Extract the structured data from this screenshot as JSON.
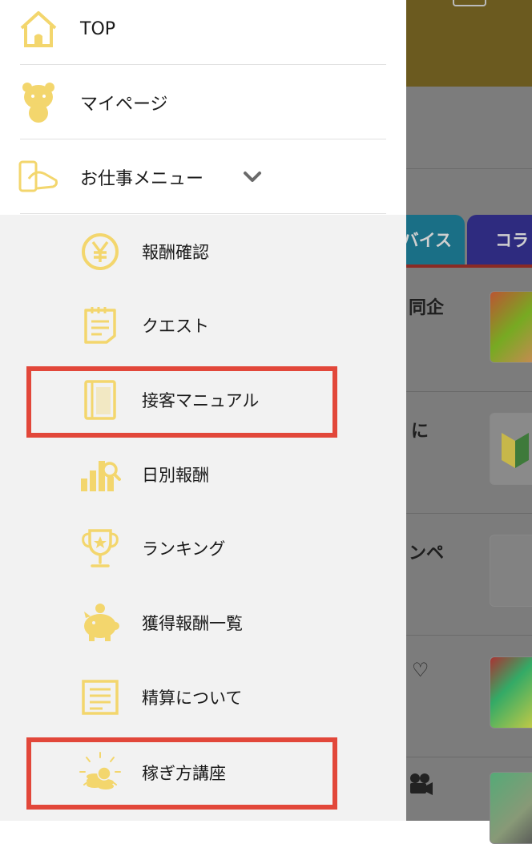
{
  "colors": {
    "icon_yellow": "#f3d66d",
    "highlight_red": "#e2473a",
    "drawer_bg": "#f2f2f2"
  },
  "drawer": {
    "primary_items": [
      {
        "label": "TOP",
        "icon": "home-icon"
      },
      {
        "label": "マイページ",
        "icon": "bear-mascot-icon"
      },
      {
        "label": "お仕事メニュー",
        "icon": "hand-phone-icon",
        "expanded": true
      }
    ],
    "sub_items": [
      {
        "label": "報酬確認",
        "icon": "yen-coin-icon",
        "highlighted": false
      },
      {
        "label": "クエスト",
        "icon": "notepad-icon",
        "highlighted": false
      },
      {
        "label": "接客マニュアル",
        "icon": "book-icon",
        "highlighted": true
      },
      {
        "label": "日別報酬",
        "icon": "bar-chart-search-icon",
        "highlighted": false
      },
      {
        "label": "ランキング",
        "icon": "trophy-icon",
        "highlighted": false
      },
      {
        "label": "獲得報酬一覧",
        "icon": "piggy-bank-icon",
        "highlighted": false
      },
      {
        "label": "精算について",
        "icon": "document-icon",
        "highlighted": false
      },
      {
        "label": "稼ぎ方講座",
        "icon": "coin-stack-icon",
        "highlighted": true
      }
    ]
  },
  "background_page": {
    "tabs": [
      {
        "label": "バイス"
      },
      {
        "label": "コラ"
      }
    ],
    "snippets": [
      "同企",
      "に",
      "ンペ",
      "♡"
    ]
  }
}
